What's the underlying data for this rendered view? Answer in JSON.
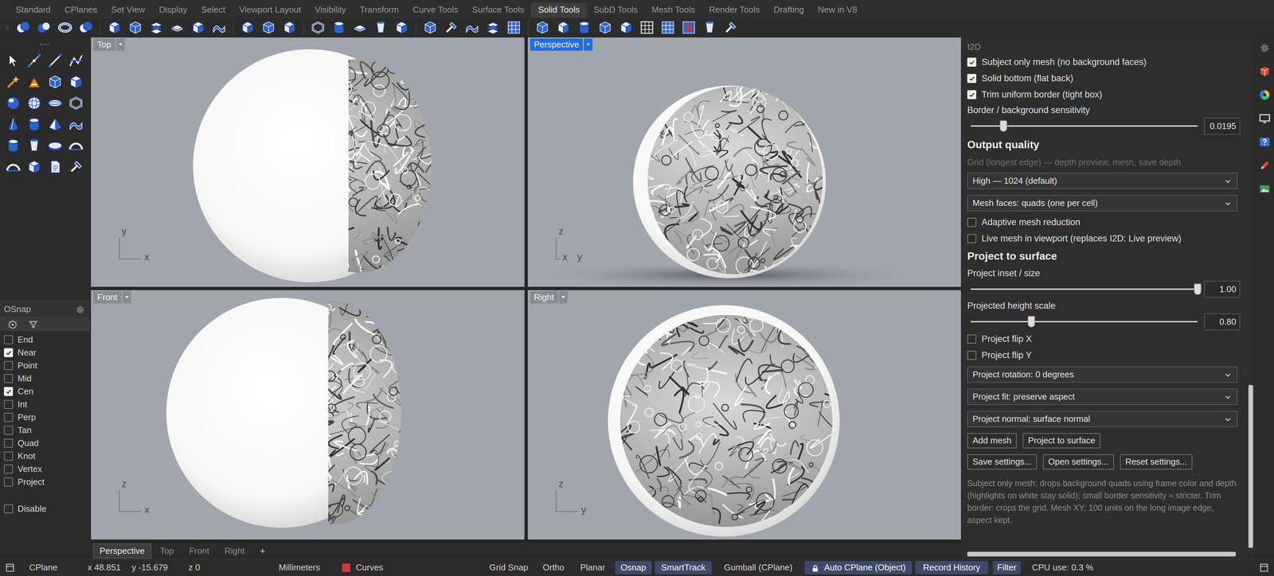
{
  "ribbon_tabs": [
    {
      "label": "Standard",
      "selected": false
    },
    {
      "label": "CPlanes",
      "selected": false
    },
    {
      "label": "Set View",
      "selected": false
    },
    {
      "label": "Display",
      "selected": false
    },
    {
      "label": "Select",
      "selected": false
    },
    {
      "label": "Viewport Layout",
      "selected": false
    },
    {
      "label": "Visibility",
      "selected": false
    },
    {
      "label": "Transform",
      "selected": false
    },
    {
      "label": "Curve Tools",
      "selected": false
    },
    {
      "label": "Surface Tools",
      "selected": false
    },
    {
      "label": "Solid Tools",
      "selected": true
    },
    {
      "label": "SubD Tools",
      "selected": false
    },
    {
      "label": "Mesh Tools",
      "selected": false
    },
    {
      "label": "Render Tools",
      "selected": false
    },
    {
      "label": "Drafting",
      "selected": false
    },
    {
      "label": "New in V8",
      "selected": false
    }
  ],
  "viewports": [
    {
      "title": "Top",
      "selected": false,
      "axes": [
        "y",
        "x"
      ]
    },
    {
      "title": "Perspective",
      "selected": true,
      "axes": [
        "z",
        "x",
        "y"
      ]
    },
    {
      "title": "Front",
      "selected": false,
      "axes": [
        "z",
        "x"
      ]
    },
    {
      "title": "Right",
      "selected": false,
      "axes": [
        "z",
        "y"
      ]
    }
  ],
  "viewport_tabs": [
    {
      "label": "Perspective",
      "selected": true
    },
    {
      "label": "Top",
      "selected": false
    },
    {
      "label": "Front",
      "selected": false
    },
    {
      "label": "Right",
      "selected": false
    }
  ],
  "add_tab": "+",
  "osnap": {
    "title": "OSnap",
    "items": [
      {
        "label": "End",
        "checked": false
      },
      {
        "label": "Near",
        "checked": true
      },
      {
        "label": "Point",
        "checked": false
      },
      {
        "label": "Mid",
        "checked": false
      },
      {
        "label": "Cen",
        "checked": true
      },
      {
        "label": "Int",
        "checked": false
      },
      {
        "label": "Perp",
        "checked": false
      },
      {
        "label": "Tan",
        "checked": false
      },
      {
        "label": "Quad",
        "checked": false
      },
      {
        "label": "Knot",
        "checked": false
      },
      {
        "label": "Vertex",
        "checked": false
      },
      {
        "label": "Project",
        "checked": false
      }
    ],
    "disable": {
      "label": "Disable",
      "checked": false
    }
  },
  "status_bar": {
    "items": [
      {
        "label": "CPlane",
        "kind": "text"
      },
      {
        "label": "x 48.851",
        "kind": "text"
      },
      {
        "label": "y -15.679",
        "kind": "text"
      },
      {
        "label": "z 0",
        "kind": "text"
      },
      {
        "label": "Millimeters",
        "kind": "text"
      },
      {
        "label": "Curves",
        "kind": "layer",
        "color": "#c83a3a"
      },
      {
        "label": "Grid Snap",
        "kind": "toggle",
        "on": false,
        "locked": false
      },
      {
        "label": "Ortho",
        "kind": "toggle",
        "on": false,
        "locked": false
      },
      {
        "label": "Planar",
        "kind": "toggle",
        "on": false,
        "locked": false
      },
      {
        "label": "Osnap",
        "kind": "toggle",
        "on": true,
        "locked": false
      },
      {
        "label": "SmartTrack",
        "kind": "toggle",
        "on": true,
        "locked": false
      },
      {
        "label": "Gumball (CPlane)",
        "kind": "toggle",
        "on": false,
        "locked": false
      },
      {
        "label": "Auto CPlane (Object)",
        "kind": "toggle",
        "on": true,
        "locked": true
      },
      {
        "label": "Record History",
        "kind": "toggle",
        "on": true,
        "locked": false
      },
      {
        "label": "Filter",
        "kind": "toggle",
        "on": true,
        "locked": false
      },
      {
        "label": "CPU use: 0.3 %",
        "kind": "text"
      }
    ]
  },
  "panel": {
    "title": "I2D",
    "controls": [
      {
        "kind": "checkbox",
        "label": "Subject only mesh (no background faces)",
        "checked": true
      },
      {
        "kind": "checkbox",
        "label": "Solid bottom (flat back)",
        "checked": true
      },
      {
        "kind": "checkbox",
        "label": "Trim uniform border (tight box)",
        "checked": true
      },
      {
        "kind": "slider",
        "label": "Border / background sensitivity",
        "level": 0.145,
        "value": "0.0195"
      },
      {
        "kind": "heading",
        "label": "Output quality"
      },
      {
        "kind": "hint",
        "label": "Grid (longest edge) — depth preview, mesh, save depth"
      },
      {
        "kind": "select",
        "value": "High — 1024 (default)"
      },
      {
        "kind": "select",
        "value": "Mesh faces: quads (one per cell)"
      },
      {
        "kind": "checkbox",
        "label": "Adaptive mesh reduction",
        "checked": false
      },
      {
        "kind": "checkbox",
        "label": "Live mesh in viewport (replaces I2D: Live preview)",
        "checked": false
      },
      {
        "kind": "heading",
        "label": "Project to surface"
      },
      {
        "kind": "slider",
        "label": "Project inset / size",
        "level": 1.0,
        "value": "1.00"
      },
      {
        "kind": "slider",
        "label": "Projected height scale",
        "level": 0.267,
        "value": "0.80"
      },
      {
        "kind": "checkbox",
        "label": "Project flip X",
        "checked": false
      },
      {
        "kind": "checkbox",
        "label": "Project flip Y",
        "checked": false
      },
      {
        "kind": "select",
        "value": "Project rotation: 0 degrees"
      },
      {
        "kind": "select",
        "value": "Project fit: preserve aspect"
      },
      {
        "kind": "select",
        "value": "Project normal: surface normal"
      },
      {
        "kind": "buttons",
        "buttons": [
          "Add mesh",
          "Project to surface"
        ]
      },
      {
        "kind": "buttons",
        "buttons": [
          "Save settings...",
          "Open settings...",
          "Reset settings..."
        ]
      },
      {
        "kind": "note",
        "text": "Subject only mesh: drops background quads using frame color and depth (highlights on white stay solid); small border sensitivity ≈ stricter. Trim border: crops the grid. Mesh XY: 100 units on the long image edge, aspect kept."
      }
    ],
    "scrollbar": {
      "v_start": 0.68,
      "v_size": 0.32,
      "h_start": 0.0,
      "h_size": 0.97
    }
  }
}
